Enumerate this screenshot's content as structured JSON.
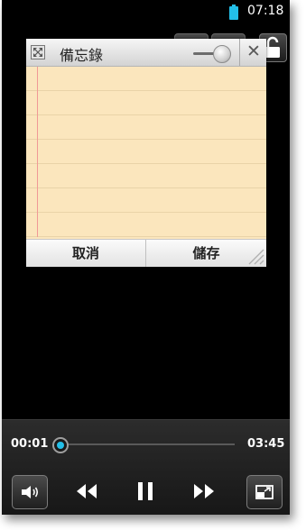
{
  "status_bar": {
    "time": "07:18",
    "battery_color": "#23bfe8"
  },
  "memo": {
    "title": "備忘錄",
    "text": "",
    "cancel_label": "取消",
    "save_label": "儲存"
  },
  "player": {
    "elapsed": "00:01",
    "total": "03:45",
    "progress_fraction": 0.004,
    "accent_color": "#23bfe8"
  }
}
